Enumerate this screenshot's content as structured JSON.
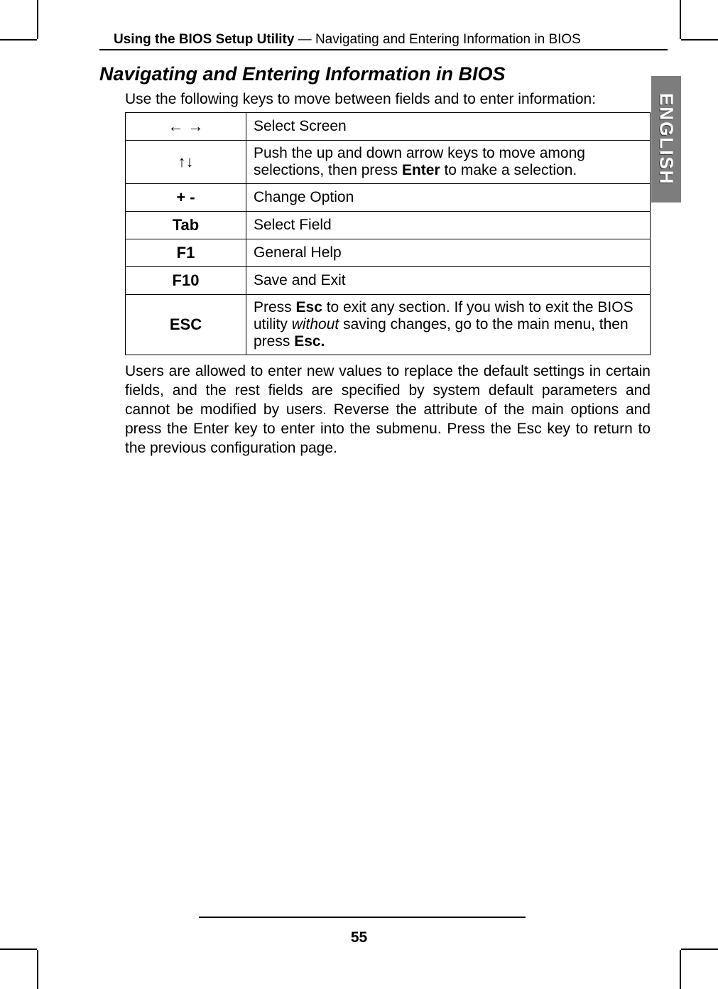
{
  "sideTab": "ENGLISH",
  "header": {
    "bold": "Using the BIOS Setup Utility",
    "rest": " — Navigating and Entering Information in BIOS"
  },
  "heading": "Navigating and Entering Information in BIOS",
  "intro": "Use the following keys to move between fields and to enter information:",
  "rows": [
    {
      "key": "←  →",
      "desc": "Select Screen",
      "keyClass": "arrows"
    },
    {
      "key": "↑↓",
      "descHtml": "Push the up and down arrow keys to move among selections, then press <b>Enter</b> to make a selection.",
      "keyClass": "arrows"
    },
    {
      "key": "+  -",
      "desc": "Change Option"
    },
    {
      "key": "Tab",
      "desc": "Select Field"
    },
    {
      "key": "F1",
      "desc": "General Help"
    },
    {
      "key": "F10",
      "desc": "Save and Exit"
    },
    {
      "key": "ESC",
      "descHtml": "Press <b>Esc</b> to exit any section. If you wish to exit the BIOS utility <i>without</i> saving changes, go to the main menu, then press <b>Esc.</b>"
    }
  ],
  "bodyPara": "Users are allowed to enter new values to replace the default settings in certain fields, and the rest fields are specified by system default parameters and cannot be modified by users. Reverse the attribute of the main options and press the Enter key to enter into the submenu. Press the Esc key to return to the previous configuration page.",
  "pageNumber": "55"
}
